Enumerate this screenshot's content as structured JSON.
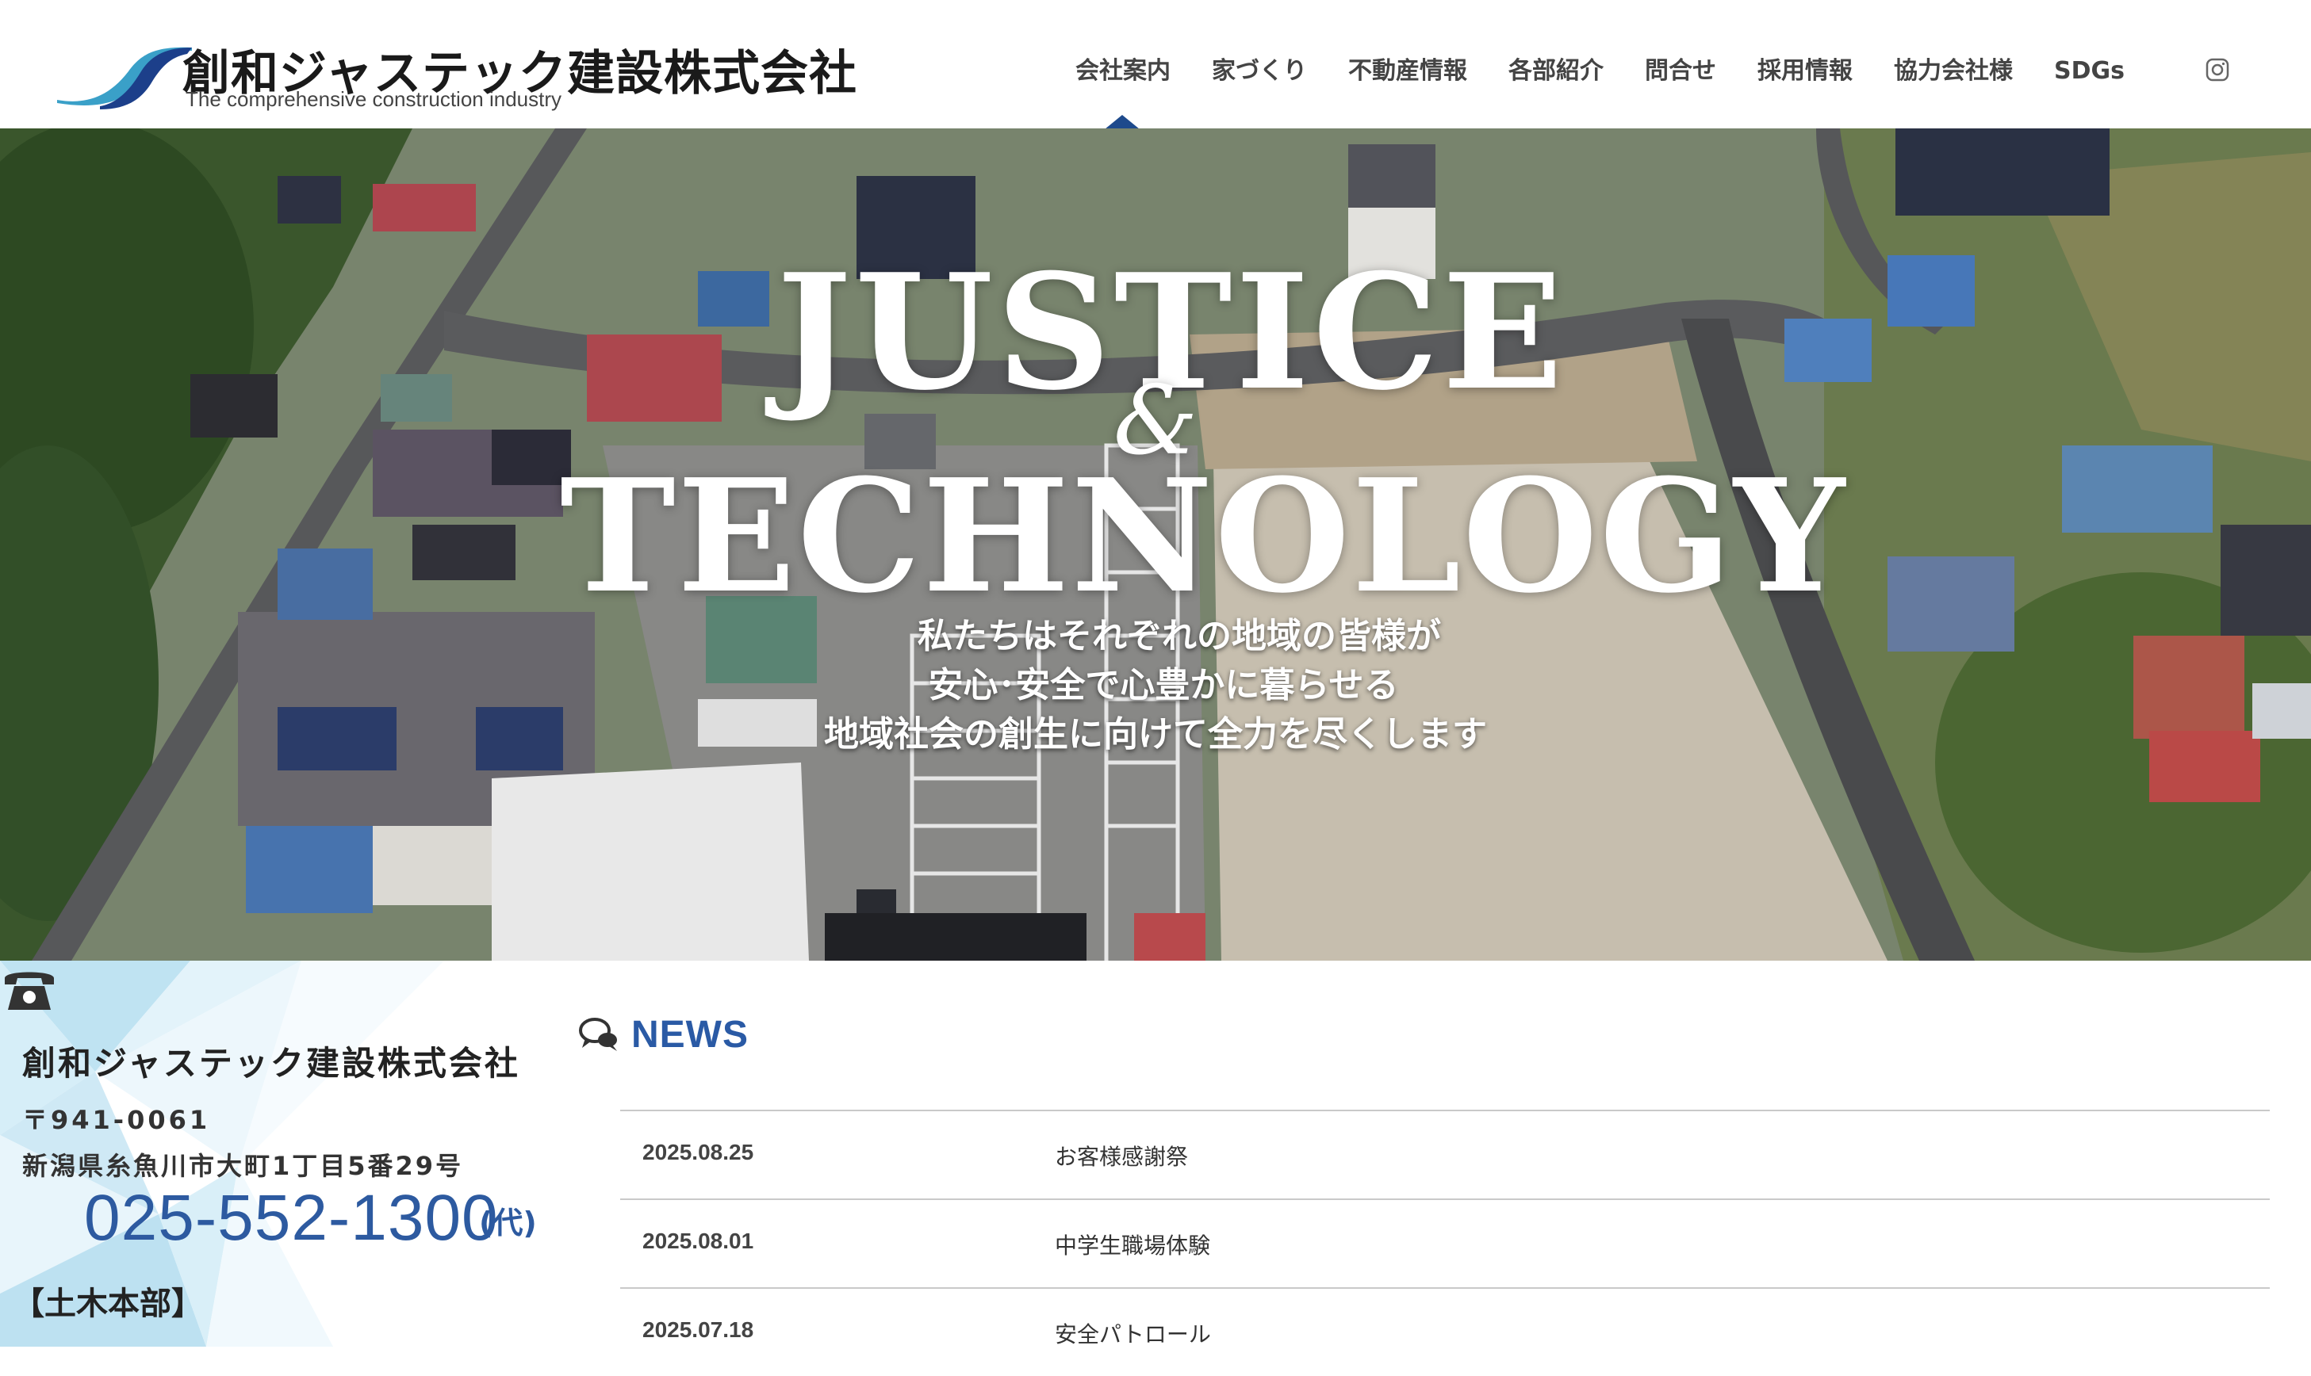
{
  "header": {
    "company_name": "創和ジャステック建設株式会社",
    "tagline": "The comprehensive construction industry",
    "nav": [
      {
        "label": "会社案内"
      },
      {
        "label": "家づくり"
      },
      {
        "label": "不動産情報"
      },
      {
        "label": "各部紹介"
      },
      {
        "label": "問合せ"
      },
      {
        "label": "採用情報"
      },
      {
        "label": "協力会社様"
      },
      {
        "label": "SDGs"
      }
    ],
    "instagram_icon": "instagram-icon"
  },
  "hero": {
    "title_line1": "JUSTICE",
    "title_amp": "&",
    "title_line2": "TECHNOLOGY",
    "subtitle_line1": "私たちはそれぞれの地域の皆様が",
    "subtitle_line2": "安心･安全で心豊かに暮らせる",
    "subtitle_line3": "地域社会の創生に向けて全力を尽くします"
  },
  "info": {
    "company_name": "創和ジャステック建設株式会社",
    "zip": "〒941-0061",
    "address": "新潟県糸魚川市大町1丁目5番29号",
    "tel": "025-552-1300",
    "tel_note": "(代)",
    "department": "【土木本部】"
  },
  "news": {
    "title": "NEWS",
    "items": [
      {
        "date": "2025.08.25",
        "text": "お客様感謝祭"
      },
      {
        "date": "2025.08.01",
        "text": "中学生職場体験"
      },
      {
        "date": "2025.07.18",
        "text": "安全パトロール"
      }
    ]
  },
  "colors": {
    "accent": "#1e4a8c",
    "news_blue": "#2a5aa5",
    "phone_blue": "#2d5aa0",
    "logo_cyan": "#3aa0c8",
    "logo_navy": "#1c3f8a"
  }
}
